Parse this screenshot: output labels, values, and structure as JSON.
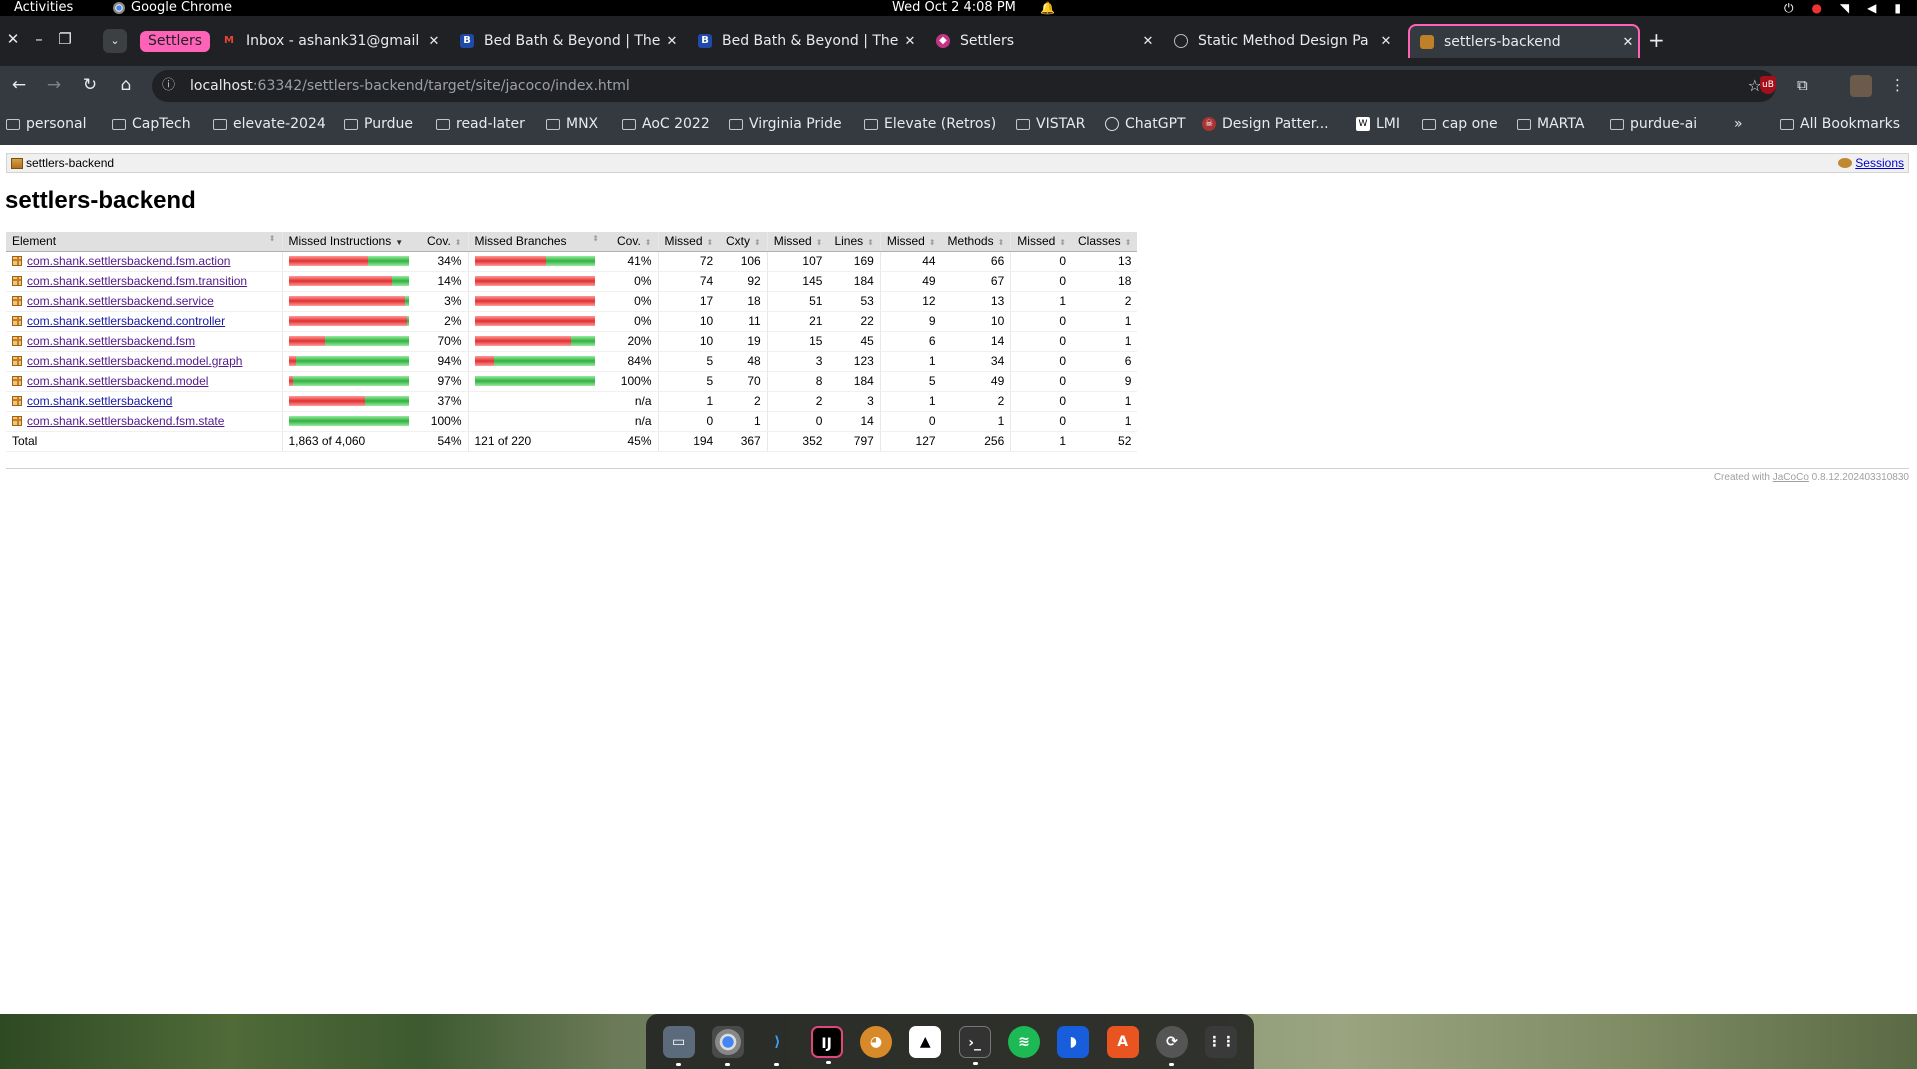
{
  "topbar": {
    "activities": "Activities",
    "app_name": "Google Chrome",
    "clock": "Wed Oct 2   4:08 PM"
  },
  "tabs": {
    "group_label": "Settlers",
    "items": [
      {
        "title": "Inbox - ashank31@gmail",
        "favicon": "gmail-icon",
        "color": "#ea4335"
      },
      {
        "title": "Bed Bath & Beyond | The",
        "favicon": "bbb-icon",
        "color": "#1f4aa8"
      },
      {
        "title": "Bed Bath & Beyond | The",
        "favicon": "bbb-icon",
        "color": "#1f4aa8"
      },
      {
        "title": "Settlers",
        "favicon": "settlers-icon",
        "color": "#c13584"
      },
      {
        "title": "Static Method Design Pa",
        "favicon": "chatgpt-icon",
        "color": "#555555"
      },
      {
        "title": "settlers-backend",
        "favicon": "jacoco-icon",
        "color": "#c08028"
      }
    ]
  },
  "omnibox": {
    "host": "localhost",
    "path": ":63342/settlers-backend/target/site/jacoco/index.html"
  },
  "bookmarks": [
    "personal",
    "CapTech",
    "elevate-2024",
    "Purdue",
    "read-later",
    "MNX",
    "AoC 2022",
    "Virginia Pride",
    "Elevate (Retros)",
    "VISTAR",
    "ChatGPT",
    "Design Patter...",
    "LMI",
    "cap one",
    "MARTA",
    "purdue-ai"
  ],
  "all_bookmarks": "All Bookmarks",
  "page": {
    "breadcrumb": "settlers-backend",
    "sessions": "Sessions",
    "title": "settlers-backend",
    "headers": [
      "Element",
      "Missed Instructions",
      "Cov.",
      "Missed Branches",
      "Cov.",
      "Missed",
      "Cxty",
      "Missed",
      "Lines",
      "Missed",
      "Methods",
      "Missed",
      "Classes"
    ],
    "rows": [
      {
        "name": "com.shank.settlersbackend.fsm.action",
        "visited": true,
        "instr_missed": 0.66,
        "instr_covered": 0.34,
        "instr_cov": "34%",
        "br_missed": 0.59,
        "br_covered": 0.41,
        "br_cov": "41%",
        "m_cx": "72",
        "cx": "106",
        "m_ln": "107",
        "ln": "169",
        "m_me": "44",
        "me": "66",
        "m_cl": "0",
        "cl": "13"
      },
      {
        "name": "com.shank.settlersbackend.fsm.transition",
        "visited": true,
        "instr_missed": 0.86,
        "instr_covered": 0.14,
        "instr_cov": "14%",
        "br_missed": 1.0,
        "br_covered": 0.0,
        "br_cov": "0%",
        "m_cx": "74",
        "cx": "92",
        "m_ln": "145",
        "ln": "184",
        "m_me": "49",
        "me": "67",
        "m_cl": "0",
        "cl": "18"
      },
      {
        "name": "com.shank.settlersbackend.service",
        "visited": true,
        "instr_missed": 0.97,
        "instr_covered": 0.03,
        "instr_cov": "3%",
        "br_missed": 1.0,
        "br_covered": 0.0,
        "br_cov": "0%",
        "m_cx": "17",
        "cx": "18",
        "m_ln": "51",
        "ln": "53",
        "m_me": "12",
        "me": "13",
        "m_cl": "1",
        "cl": "2"
      },
      {
        "name": "com.shank.settlersbackend.controller",
        "visited": false,
        "instr_missed": 0.98,
        "instr_covered": 0.02,
        "instr_cov": "2%",
        "br_missed": 1.0,
        "br_covered": 0.0,
        "br_cov": "0%",
        "m_cx": "10",
        "cx": "11",
        "m_ln": "21",
        "ln": "22",
        "m_me": "9",
        "me": "10",
        "m_cl": "0",
        "cl": "1"
      },
      {
        "name": "com.shank.settlersbackend.fsm",
        "visited": true,
        "instr_missed": 0.3,
        "instr_covered": 0.7,
        "instr_cov": "70%",
        "br_missed": 0.8,
        "br_covered": 0.2,
        "br_cov": "20%",
        "m_cx": "10",
        "cx": "19",
        "m_ln": "15",
        "ln": "45",
        "m_me": "6",
        "me": "14",
        "m_cl": "0",
        "cl": "1"
      },
      {
        "name": "com.shank.settlersbackend.model.graph",
        "visited": true,
        "instr_missed": 0.06,
        "instr_covered": 0.94,
        "instr_cov": "94%",
        "br_missed": 0.16,
        "br_covered": 0.84,
        "br_cov": "84%",
        "m_cx": "5",
        "cx": "48",
        "m_ln": "3",
        "ln": "123",
        "m_me": "1",
        "me": "34",
        "m_cl": "0",
        "cl": "6"
      },
      {
        "name": "com.shank.settlersbackend.model",
        "visited": true,
        "instr_missed": 0.03,
        "instr_covered": 0.97,
        "instr_cov": "97%",
        "br_missed": 0.0,
        "br_covered": 1.0,
        "br_cov": "100%",
        "m_cx": "5",
        "cx": "70",
        "m_ln": "8",
        "ln": "184",
        "m_me": "5",
        "me": "49",
        "m_cl": "0",
        "cl": "9"
      },
      {
        "name": "com.shank.settlersbackend",
        "visited": false,
        "instr_missed": 0.63,
        "instr_covered": 0.37,
        "instr_cov": "37%",
        "br_missed": 0,
        "br_covered": 0,
        "br_cov": "n/a",
        "m_cx": "1",
        "cx": "2",
        "m_ln": "2",
        "ln": "3",
        "m_me": "1",
        "me": "2",
        "m_cl": "0",
        "cl": "1"
      },
      {
        "name": "com.shank.settlersbackend.fsm.state",
        "visited": true,
        "instr_missed": 0.0,
        "instr_covered": 1.0,
        "instr_cov": "100%",
        "br_missed": 0,
        "br_covered": 0,
        "br_cov": "n/a",
        "m_cx": "0",
        "cx": "1",
        "m_ln": "0",
        "ln": "14",
        "m_me": "0",
        "me": "1",
        "m_cl": "0",
        "cl": "1"
      }
    ],
    "total": {
      "label": "Total",
      "instr": "1,863 of 4,060",
      "instr_cov": "54%",
      "br": "121 of 220",
      "br_cov": "45%",
      "m_cx": "194",
      "cx": "367",
      "m_ln": "352",
      "ln": "797",
      "m_me": "127",
      "me": "256",
      "m_cl": "1",
      "cl": "52"
    },
    "footer_prefix": "Created with",
    "footer_link": "JaCoCo",
    "footer_version": "0.8.12.202403310830"
  },
  "dock": [
    "Files",
    "Chrome",
    "VS Code",
    "IntelliJ",
    "Postman",
    "Inkscape",
    "Terminal",
    "Spotify",
    "Bitwarden",
    "Software",
    "Updater",
    "Apps"
  ]
}
